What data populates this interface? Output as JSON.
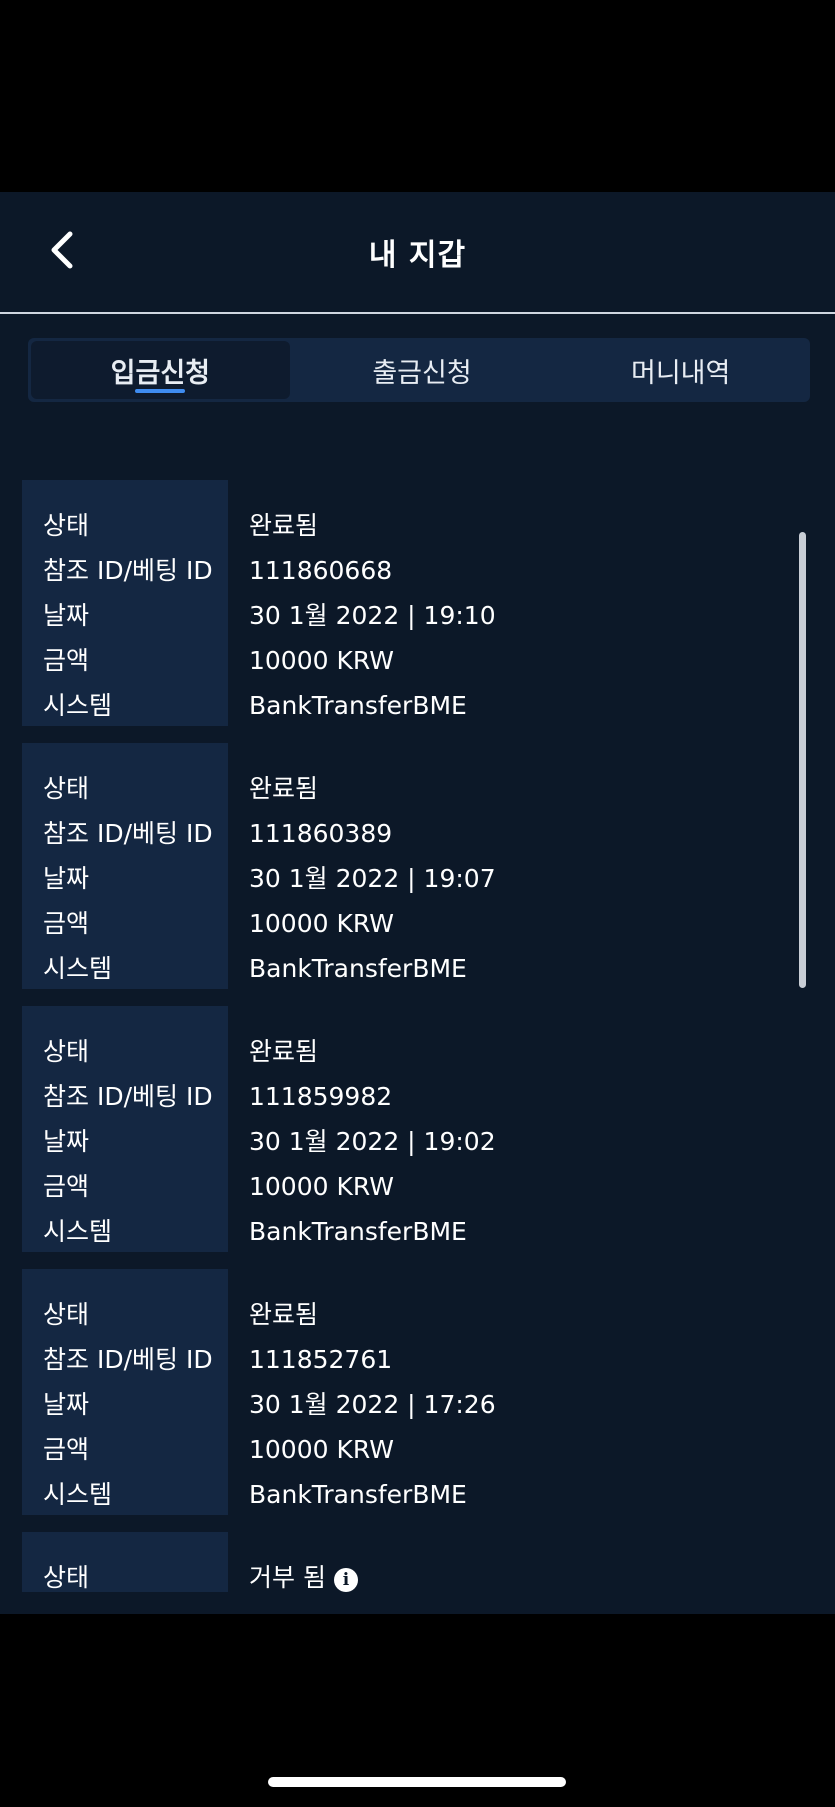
{
  "header": {
    "title": "내 지갑",
    "back_icon": "chevron-left-icon"
  },
  "tabs": [
    {
      "label": "입금신청",
      "active": true
    },
    {
      "label": "출금신청",
      "active": false
    },
    {
      "label": "머니내역",
      "active": false
    }
  ],
  "field_labels": {
    "status": "상태",
    "reference": "참조 ID/베팅 ID",
    "date": "날짜",
    "amount": "금액",
    "system": "시스템"
  },
  "records": [
    {
      "status": "완료됨",
      "reference": "111860668",
      "date": "30 1월 2022 | 19:10",
      "amount": "10000 KRW",
      "system": "BankTransferBME"
    },
    {
      "status": "완료됨",
      "reference": "111860389",
      "date": "30 1월 2022 | 19:07",
      "amount": "10000 KRW",
      "system": "BankTransferBME"
    },
    {
      "status": "완료됨",
      "reference": "111859982",
      "date": "30 1월 2022 | 19:02",
      "amount": "10000 KRW",
      "system": "BankTransferBME"
    },
    {
      "status": "완료됨",
      "reference": "111852761",
      "date": "30 1월 2022 | 17:26",
      "amount": "10000 KRW",
      "system": "BankTransferBME"
    },
    {
      "status": "거부 됨",
      "status_icon": "info-icon",
      "partial": true
    }
  ],
  "colors": {
    "background": "#0c1828",
    "label_column": "#142742",
    "tab_bar": "#142742",
    "active_underline": "#3f8cf0"
  }
}
